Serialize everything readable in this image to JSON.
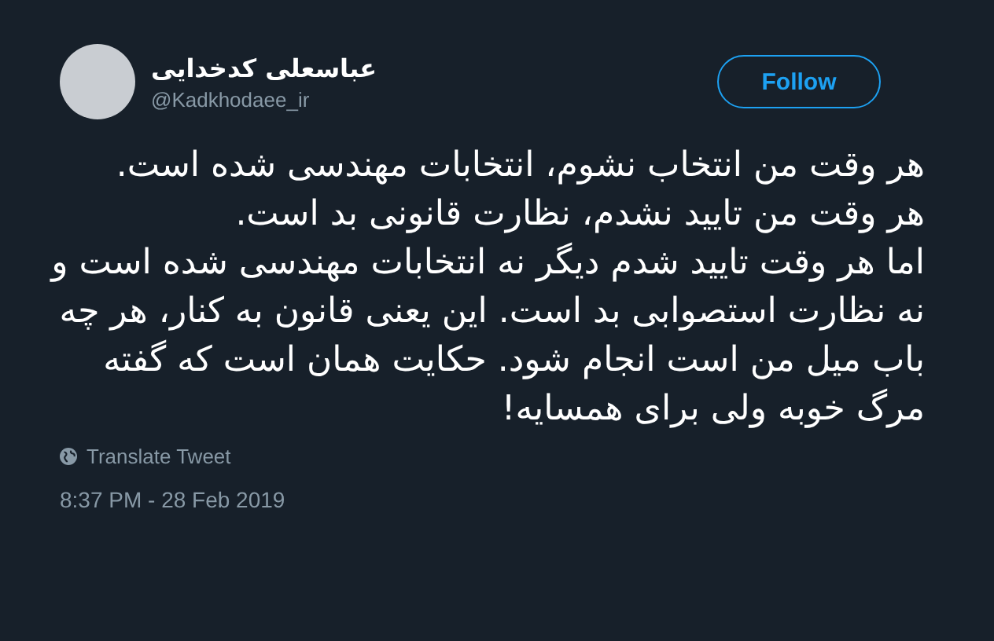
{
  "author": {
    "name": "عباسعلی کدخدایی",
    "handle": "@Kadkhodaee_ir"
  },
  "follow_button": {
    "label": "Follow"
  },
  "tweet": {
    "paragraphs": [
      "هر وقت من انتخاب نشوم، انتخابات مهندسی شده است.",
      "هر وقت من تایید نشدم، نظارت قانونی بد است.",
      "اما هر وقت تایید شدم دیگر نه انتخابات مهندسی شده است و نه نظارت استصوابی بد است. این یعنی قانون به کنار، هر چه باب میل من است انجام شود. حکایت همان است که گفته مرگ خوبه ولی برای همسایه!"
    ]
  },
  "translate_link": "Translate Tweet",
  "timestamp": "8:37 PM - 28 Feb 2019"
}
